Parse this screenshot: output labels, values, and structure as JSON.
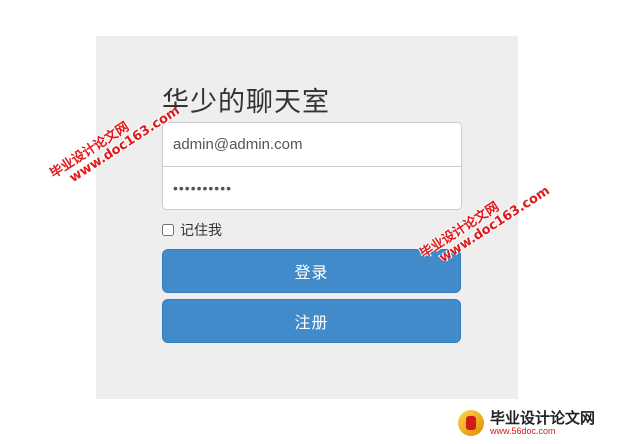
{
  "login": {
    "title": "华少的聊天室",
    "email_value": "admin@admin.com",
    "password_value": "••••••••••",
    "remember_label": "记住我",
    "login_button": "登录",
    "register_button": "注册"
  },
  "watermarks": {
    "site_name": "毕业设计论文网",
    "site_url": "www.doc163.com"
  },
  "footer_logo": {
    "name": "毕业设计论文网",
    "url": "www.56doc.com"
  },
  "colors": {
    "panel_bg": "#eeeeee",
    "primary_button": "#428bca",
    "watermark": "#e01a1a"
  }
}
